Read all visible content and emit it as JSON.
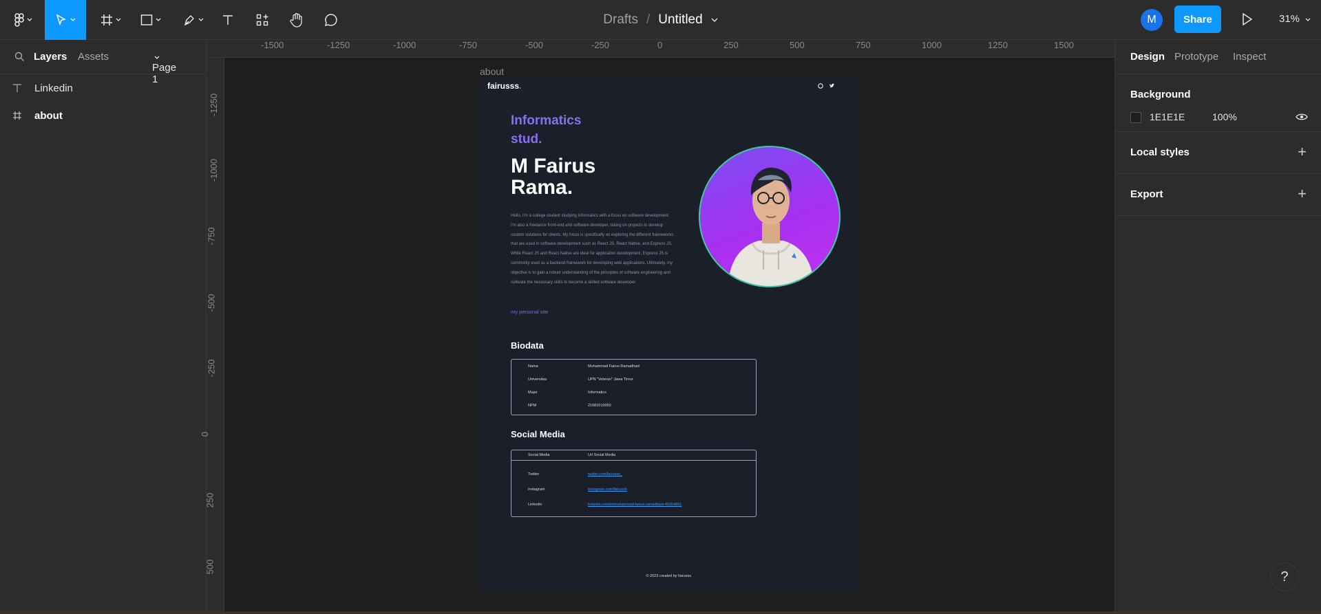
{
  "toolbar": {
    "tools": [
      "main-menu",
      "move",
      "frame",
      "shape",
      "pen",
      "text",
      "resources",
      "hand",
      "comment"
    ]
  },
  "breadcrumb": {
    "location": "Drafts",
    "separator": "/",
    "file": "Untitled"
  },
  "header": {
    "avatar_initial": "M",
    "share_label": "Share",
    "zoom": "31%"
  },
  "left_panel": {
    "tabs": [
      "Layers",
      "Assets"
    ],
    "page": "Page 1",
    "layers": [
      {
        "icon": "text-icon",
        "name": "Linkedin"
      },
      {
        "icon": "frame-icon",
        "name": "about"
      }
    ]
  },
  "right_panel": {
    "tabs": [
      "Design",
      "Prototype",
      "Inspect"
    ],
    "background_label": "Background",
    "background_hex": "1E1E1E",
    "background_opacity": "100%",
    "local_styles": "Local styles",
    "export": "Export"
  },
  "rulers": {
    "top": [
      "-1500",
      "-1250",
      "-1000",
      "-750",
      "-500",
      "-250",
      "0",
      "250",
      "500",
      "750",
      "1000",
      "1250",
      "1500"
    ],
    "left": [
      "-1250",
      "-1000",
      "-750",
      "-500",
      "-250",
      "0",
      "250",
      "500"
    ]
  },
  "frame": {
    "label": "about",
    "brand": "fairusss",
    "brand_dot": ".",
    "role_line1": "Informatics",
    "role_line2": "stud.",
    "name_line1": "M Fairus",
    "name_line2": "Rama.",
    "bio": "Hello, I'm a college student studying Informatics with a focus on software development. I'm also a freelance front-end and software developer, taking on projects to develop custom solutions for clients. My focus is specifically on exploring the different frameworks that are used in software development such as React JS, React Native, and Express JS. While React JS and React Native are ideal for application development, Express JS is commonly used as a backend framework for developing web applications. Ultimately, my objective is to gain a robust understanding of the principles of software engineering and cultivate the necessary skills to become a skilled software developer.",
    "site_link": "my personal site",
    "biodata_title": "Biodata",
    "biodata": [
      {
        "key": "Nama",
        "value": "Muhammad Fairus Ramadhani"
      },
      {
        "key": "Universitas",
        "value": "UPN \"Veteran\" Jawa Timur"
      },
      {
        "key": "Major",
        "value": "Informatics"
      },
      {
        "key": "NPM",
        "value": "21081010050"
      }
    ],
    "social_title": "Social Media",
    "social_header": {
      "key": "Social Media",
      "value": "Url Social Media"
    },
    "social": [
      {
        "key": "Twitter",
        "value": "twitter.com/fairusss_"
      },
      {
        "key": "Instagram",
        "value": "instagram.com/fairussh"
      },
      {
        "key": "Linkedin",
        "value": "linkedin.com/in/muhammad-fairus-ramadhani-46954861"
      }
    ],
    "footer": "© 2023 created by fairusss."
  },
  "help_label": "?"
}
